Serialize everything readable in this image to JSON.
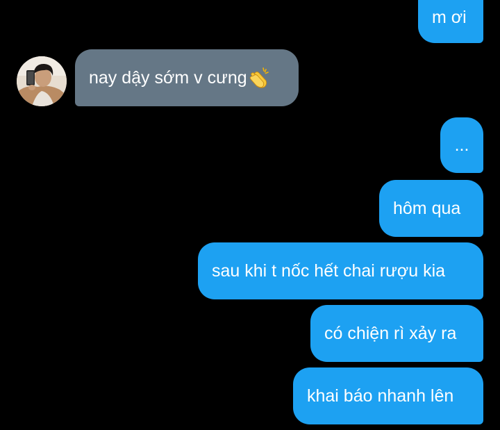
{
  "conversation": {
    "messages": [
      {
        "sender": "me",
        "text": "m ơi"
      },
      {
        "sender": "other",
        "text": "nay dậy sớm v cưng",
        "emoji": "clapping-hands-icon"
      },
      {
        "sender": "me",
        "text": "..."
      },
      {
        "sender": "me",
        "text": "hôm qua"
      },
      {
        "sender": "me",
        "text": "sau khi t nốc hết chai rượu kia"
      },
      {
        "sender": "me",
        "text": "có chiện rì xảy ra"
      },
      {
        "sender": "me",
        "text": "khai báo nhanh lên"
      }
    ]
  },
  "colors": {
    "background": "#000000",
    "outgoing_bubble": "#1da1f2",
    "incoming_bubble": "#657786",
    "text": "#ffffff"
  }
}
